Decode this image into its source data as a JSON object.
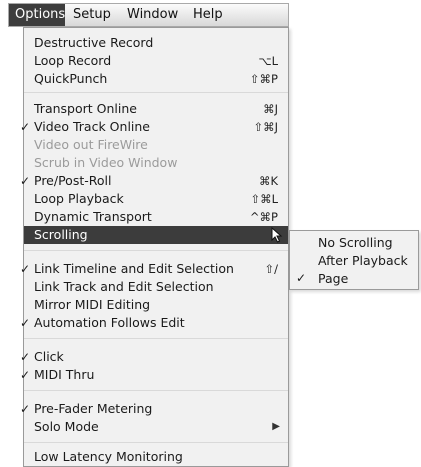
{
  "menubar": {
    "items": [
      "Options",
      "Setup",
      "Window",
      "Help"
    ],
    "active_index": 0
  },
  "menu": {
    "items": [
      {
        "label": "Destructive Record",
        "shortcut": "",
        "checked": false,
        "disabled": false
      },
      {
        "label": "Loop Record",
        "shortcut": "⌥L",
        "checked": false,
        "disabled": false
      },
      {
        "label": "QuickPunch",
        "shortcut": "⇧⌘P",
        "checked": false,
        "disabled": false
      },
      {
        "separator": true
      },
      {
        "label": "Transport Online",
        "shortcut": "⌘J",
        "checked": false,
        "disabled": false
      },
      {
        "label": "Video Track Online",
        "shortcut": "⇧⌘J",
        "checked": true,
        "disabled": false
      },
      {
        "label": "Video out FireWire",
        "shortcut": "",
        "checked": false,
        "disabled": true
      },
      {
        "label": "Scrub in Video Window",
        "shortcut": "",
        "checked": false,
        "disabled": true
      },
      {
        "label": "Pre/Post-Roll",
        "shortcut": "⌘K",
        "checked": true,
        "disabled": false
      },
      {
        "label": "Loop Playback",
        "shortcut": "⇧⌘L",
        "checked": false,
        "disabled": false
      },
      {
        "label": "Dynamic Transport",
        "shortcut": "^⌘P",
        "checked": false,
        "disabled": false
      },
      {
        "label": "Scrolling",
        "shortcut": "",
        "checked": false,
        "disabled": false,
        "highlight": true,
        "has_submenu": true
      },
      {
        "separator": true
      },
      {
        "label": "Link Timeline and Edit Selection",
        "shortcut": "⇧/",
        "checked": true,
        "disabled": false
      },
      {
        "label": "Link Track and Edit Selection",
        "shortcut": "",
        "checked": false,
        "disabled": false
      },
      {
        "label": "Mirror MIDI Editing",
        "shortcut": "",
        "checked": false,
        "disabled": false
      },
      {
        "label": "Automation Follows Edit",
        "shortcut": "",
        "checked": true,
        "disabled": false
      },
      {
        "separator": true
      },
      {
        "label": "Click",
        "shortcut": "",
        "checked": true,
        "disabled": false
      },
      {
        "label": "MIDI Thru",
        "shortcut": "",
        "checked": true,
        "disabled": false
      },
      {
        "separator": true
      },
      {
        "label": "Pre-Fader Metering",
        "shortcut": "",
        "checked": true,
        "disabled": false
      },
      {
        "label": "Solo Mode",
        "shortcut": "",
        "checked": false,
        "disabled": false,
        "has_submenu": true
      },
      {
        "separator": true
      },
      {
        "label": "Low Latency Monitoring",
        "shortcut": "",
        "checked": false,
        "disabled": false
      }
    ]
  },
  "submenu": {
    "items": [
      {
        "label": "No Scrolling",
        "checked": false
      },
      {
        "label": "After Playback",
        "checked": false
      },
      {
        "label": "Page",
        "checked": true
      }
    ]
  },
  "glyphs": {
    "check": "✓",
    "submenu_arrow": "▶"
  }
}
